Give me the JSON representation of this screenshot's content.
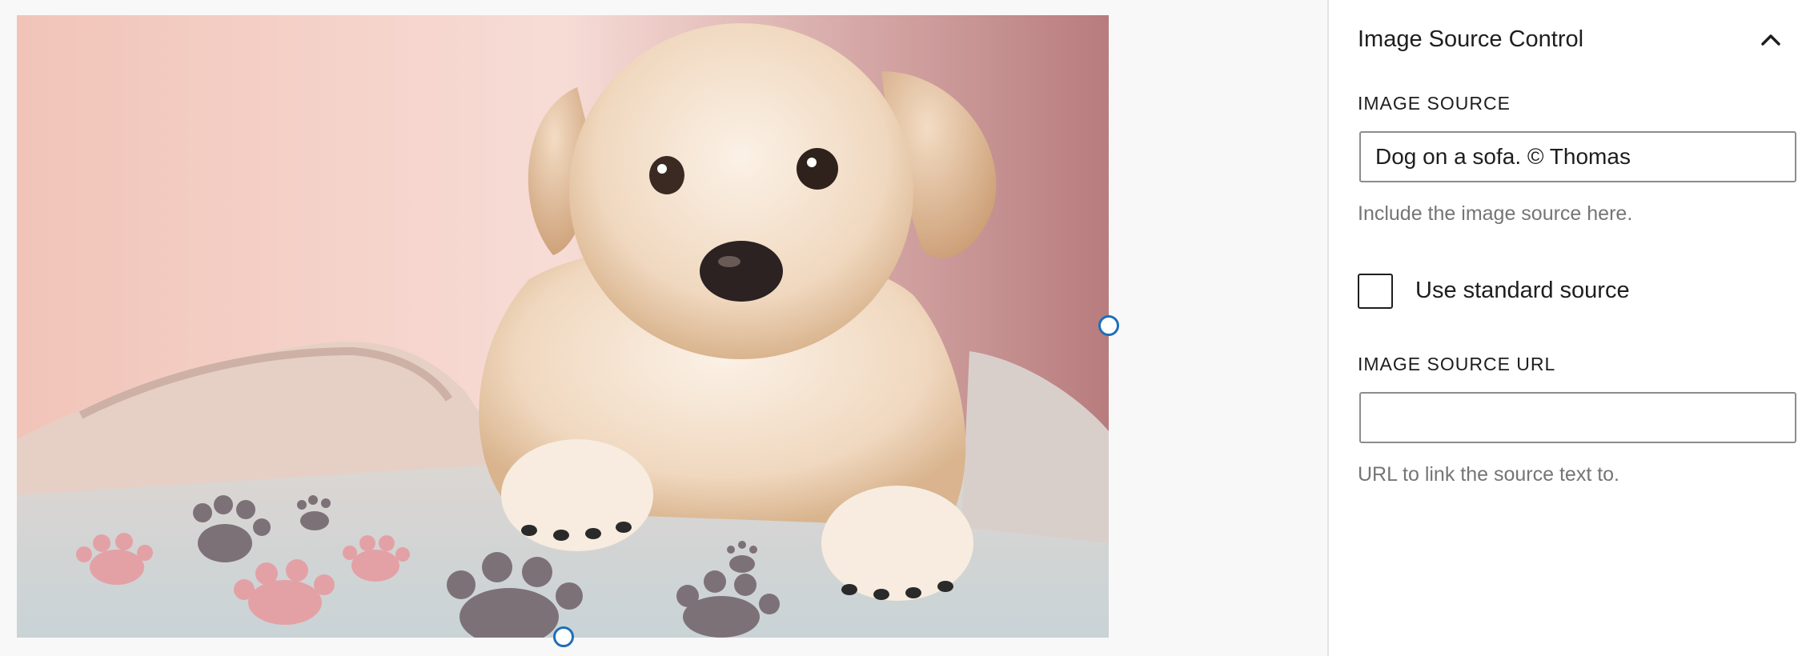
{
  "panel": {
    "title": "Image Source Control",
    "collapse_icon": "chevron-up-icon"
  },
  "image_source": {
    "label": "IMAGE SOURCE",
    "value": "Dog on a sofa. © Thomas",
    "help": "Include the image source here."
  },
  "standard_source": {
    "label": "Use standard source",
    "checked": false
  },
  "image_source_url": {
    "label": "IMAGE SOURCE URL",
    "value": "",
    "help": "URL to link the source text to."
  },
  "colors": {
    "handle_border": "#1e6fb8",
    "sidebar_bg": "#ffffff",
    "canvas_bg": "#f8f8f8"
  }
}
